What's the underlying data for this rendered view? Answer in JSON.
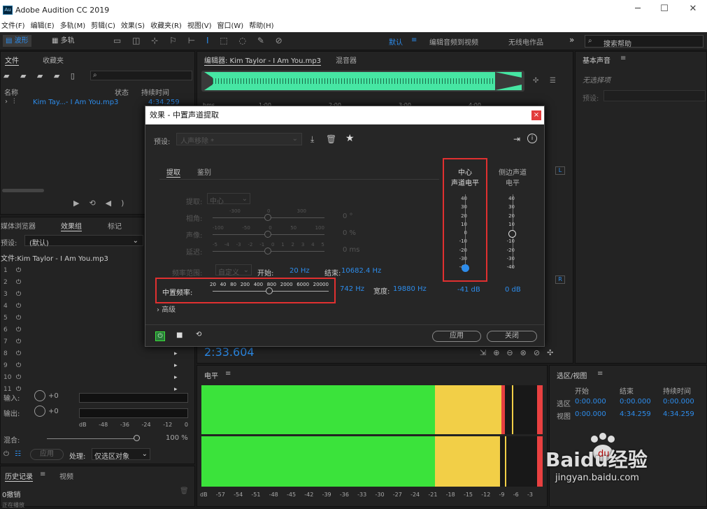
{
  "window": {
    "title": "Adobe Audition CC 2019",
    "minimize": "─",
    "maximize": "☐",
    "close": "✕",
    "icon_text": "Au"
  },
  "menu": [
    "文件(F)",
    "编辑(E)",
    "多轨(M)",
    "剪辑(C)",
    "效果(S)",
    "收藏夹(R)",
    "视图(V)",
    "窗口(W)",
    "帮助(H)"
  ],
  "toolbar": {
    "waveform": "波形",
    "multitrack": "多轨",
    "workspaces": [
      "默认",
      "编辑音频到视频",
      "无线电作品"
    ],
    "search_placeholder": "搜索帮助"
  },
  "files_panel": {
    "tabs": [
      "文件",
      "收藏夹"
    ],
    "columns": {
      "name": "名称",
      "status": "状态",
      "duration": "持续时间"
    },
    "file": {
      "name": "Kim Tay...- I Am You.mp3",
      "duration": "4:34.259"
    }
  },
  "editor": {
    "tabs": [
      "编辑器: Kim Taylor - I Am You.mp3",
      "混音器"
    ],
    "ruler": [
      "hms",
      "1:00",
      "2:00",
      "3:00",
      "4:00"
    ],
    "time": "2:33.604",
    "channels": [
      "L",
      "R"
    ]
  },
  "basic_sound": {
    "title": "基本声音",
    "no_selection": "无选择项",
    "preset": "预设:"
  },
  "effects_rack": {
    "tabs": [
      "媒体浏览器",
      "效果组",
      "标记"
    ],
    "preset_label": "预设:",
    "preset_value": "(默认)",
    "file_label": "文件:Kim Taylor - I Am You.mp3",
    "slots": [
      "1",
      "2",
      "3",
      "4",
      "5",
      "6",
      "7",
      "8",
      "9",
      "10",
      "11"
    ],
    "input": "输入:",
    "output": "输出:",
    "gain": "+0",
    "scale": [
      "dB",
      "-48",
      "-36",
      "-24",
      "-12",
      "0"
    ],
    "mix": "混合:",
    "mix_value": "100 %",
    "apply": "应用",
    "process": "处理:",
    "process_value": "仅选区对象"
  },
  "history": {
    "tabs": [
      "历史记录",
      "视频"
    ],
    "item": "0撤销",
    "status": "正在播放"
  },
  "dialog": {
    "title": "效果 - 中置声道提取",
    "preset_label": "预设:",
    "preset_value": "人声移除 *",
    "tabs": [
      "提取",
      "鉴别"
    ],
    "extract_label": "提取:",
    "extract_value": "中心",
    "phase": {
      "label": "相角:",
      "ticks": [
        "-300",
        "0",
        "300"
      ],
      "value": "0 °"
    },
    "pan": {
      "label": "声像:",
      "ticks": [
        "-100",
        "-50",
        "0",
        "50",
        "100"
      ],
      "value": "0 %"
    },
    "delay": {
      "label": "延迟:",
      "ticks": [
        "-5",
        "-4",
        "-3",
        "-2",
        "-1",
        "0",
        "1",
        "2",
        "3",
        "4",
        "5"
      ],
      "value": "0 ms"
    },
    "freq_range": {
      "label": "频率范围:",
      "value": "自定义",
      "start_label": "开始:",
      "start": "20 Hz",
      "end_label": "结束:",
      "end": "10682.4 Hz"
    },
    "center_freq": {
      "label": "中置频率:",
      "ticks": [
        "20",
        "40",
        "80",
        "200",
        "400",
        "800",
        "2000",
        "6000",
        "20000"
      ],
      "value": "742 Hz",
      "width_label": "宽度:",
      "width": "19880 Hz"
    },
    "advanced": "高级",
    "center_level": {
      "title1": "中心",
      "title2": "声道电平",
      "value": "-41 dB",
      "level_db": -41
    },
    "side_level": {
      "title1": "侧边声道",
      "title2": "电平",
      "value": "0 dB",
      "level_db": 0
    },
    "fader_ticks": [
      "40",
      "30",
      "20",
      "10",
      "0",
      "-10",
      "-20",
      "-30",
      "-40"
    ],
    "apply": "应用",
    "close": "关闭"
  },
  "levels": {
    "title": "电平",
    "scale": [
      "dB",
      "-57",
      "-54",
      "-51",
      "-48",
      "-45",
      "-42",
      "-39",
      "-36",
      "-33",
      "-30",
      "-27",
      "-24",
      "-21",
      "-18",
      "-15",
      "-12",
      "-9",
      "-6",
      "-3"
    ]
  },
  "selection": {
    "title": "选区/视图",
    "headers": [
      "开始",
      "结束",
      "持续时间"
    ],
    "rows": [
      {
        "label": "选区",
        "start": "0:00.000",
        "end": "0:00.000",
        "dur": "0:00.000"
      },
      {
        "label": "视图",
        "start": "0:00.000",
        "end": "4:34.259",
        "dur": "4:34.259"
      }
    ]
  },
  "watermark": {
    "text": "Baidu经验",
    "url": "jingyan.baidu.com"
  },
  "colors": {
    "accent": "#2d8ceb",
    "waveform": "#46e6a3",
    "meter_green": "#3be33b",
    "meter_yellow": "#f2cf47",
    "meter_red": "#e84040",
    "highlight": "#e03030"
  }
}
